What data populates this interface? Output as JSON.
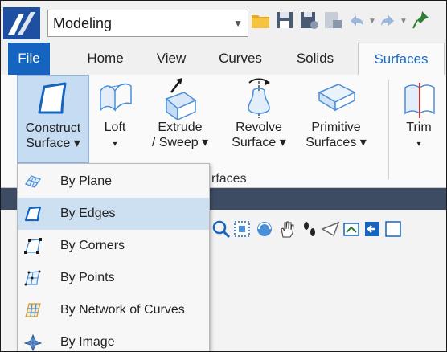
{
  "workflow": {
    "value": "Modeling"
  },
  "tabs": [
    {
      "label": "File"
    },
    {
      "label": "Home"
    },
    {
      "label": "View"
    },
    {
      "label": "Curves"
    },
    {
      "label": "Solids"
    },
    {
      "label": "Surfaces"
    }
  ],
  "ribbon": {
    "buttons": [
      {
        "line1": "Construct",
        "line2": "Surface ▾"
      },
      {
        "line1": "Loft",
        "line2": "▾"
      },
      {
        "line1": "Extrude",
        "line2": "/ Sweep ▾"
      },
      {
        "line1": "Revolve",
        "line2": "Surface ▾"
      },
      {
        "line1": "Primitive",
        "line2": "Surfaces ▾"
      },
      {
        "line1": "Trim",
        "line2": "▾"
      }
    ],
    "group_label": "rfaces"
  },
  "menu": {
    "items": [
      {
        "label": "By Plane",
        "icon": "plane-grid-icon"
      },
      {
        "label": "By Edges",
        "icon": "edges-surface-icon"
      },
      {
        "label": "By Corners",
        "icon": "corners-surface-icon"
      },
      {
        "label": "By Points",
        "icon": "points-surface-icon"
      },
      {
        "label": "By Network of Curves",
        "icon": "network-curves-icon"
      },
      {
        "label": "By Image",
        "icon": "image-surface-icon"
      }
    ],
    "highlighted_index": 1
  },
  "colors": {
    "accent": "#1565c0",
    "active_tab_text": "#1a6cc8",
    "menu_highlight": "#cde0f2",
    "view_strip": "#3d4c63"
  }
}
